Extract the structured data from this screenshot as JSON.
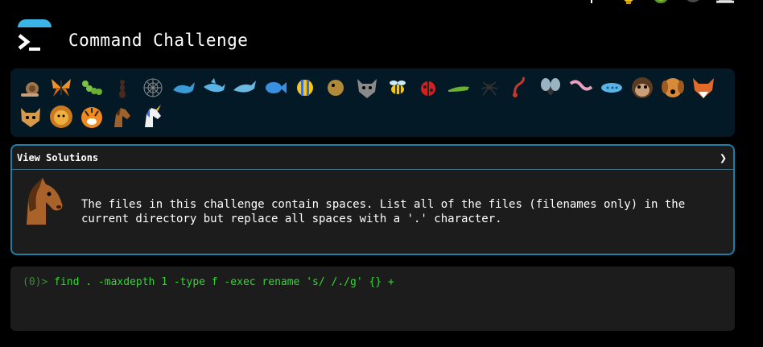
{
  "app": {
    "title": "Command Challenge"
  },
  "top_icons": [
    "code-merge-icon",
    "lightbulb-icon",
    "bug-icon",
    "avatar-icon",
    "laptop-icon"
  ],
  "achievements": {
    "icons": [
      "snail",
      "butterfly",
      "caterpillar",
      "ant",
      "spider-web",
      "whale",
      "shark",
      "dolphin",
      "fish",
      "tropical-fish",
      "blowfish",
      "wolf",
      "bee",
      "ladybug",
      "lizard",
      "spider",
      "scorpion",
      "fly",
      "worm",
      "microbe",
      "monkey",
      "dog",
      "fox",
      "cat",
      "lion",
      "tiger",
      "horse",
      "unicorn"
    ]
  },
  "solutions": {
    "label": "View Solutions",
    "chevron": "❯",
    "icon": "horse-icon",
    "description": "The files in this challenge contain spaces. List all of the files (filenames only) in the current directory but replace all spaces with a '.' character."
  },
  "terminal": {
    "prompt": "(0)>",
    "command": "find . -maxdepth 1 -type f -exec rename 's/ /./g' {} +"
  },
  "colors": {
    "accent": "#3bb4e6",
    "panel_border": "#1c7fa8",
    "strip_bg": "#031a26",
    "terminal_text": "#33d633"
  }
}
